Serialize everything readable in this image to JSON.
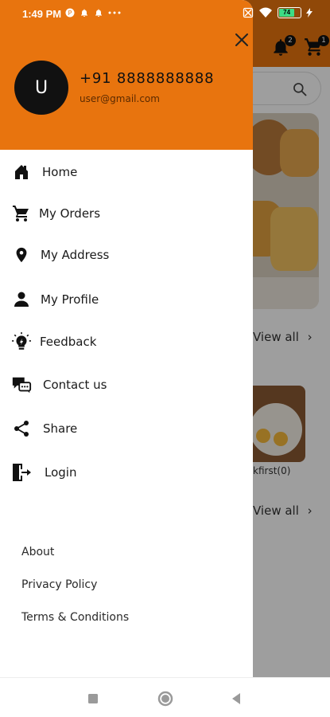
{
  "status_bar": {
    "time": "1:49 PM",
    "battery": "74"
  },
  "colors": {
    "brand_orange": "#e8740e",
    "drawer_background": "#ffffff",
    "avatar_background": "#111111"
  },
  "background_app": {
    "bell_badge": "2",
    "cart_badge": "1",
    "view_all_1": "View all",
    "view_all_2": "View all",
    "card_caption": "kfirst(0)"
  },
  "drawer": {
    "close_icon": "close-icon",
    "avatar_initial": "U",
    "phone": "+91 8888888888",
    "email": "user@gmail.com",
    "menu_items": [
      {
        "label": "Home",
        "icon": "home-icon"
      },
      {
        "label": "My Orders",
        "icon": "cart-icon"
      },
      {
        "label": "My Address",
        "icon": "location-pin-icon"
      },
      {
        "label": "My Profile",
        "icon": "person-icon"
      },
      {
        "label": "Feedback",
        "icon": "bulb-icon"
      },
      {
        "label": "Contact us",
        "icon": "chat-icon"
      },
      {
        "label": "Share",
        "icon": "share-icon"
      },
      {
        "label": "Login",
        "icon": "login-icon"
      }
    ],
    "footer_links": [
      {
        "label": "About"
      },
      {
        "label": "Privacy Policy"
      },
      {
        "label": "Terms & Conditions"
      }
    ]
  },
  "nav_bar": {
    "recents_icon": "square-icon",
    "home_icon": "circle-icon",
    "back_icon": "triangle-back-icon"
  }
}
